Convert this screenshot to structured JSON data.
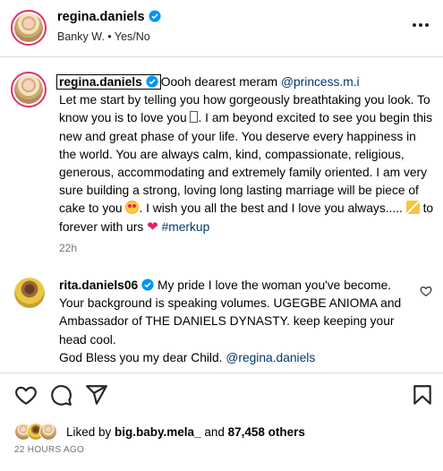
{
  "header": {
    "username": "regina.daniels",
    "subtitle": "Banky W. • Yes/No"
  },
  "caption": {
    "username": "regina.daniels",
    "text_1": "Oooh dearest meram ",
    "mention": "@princess.m.i",
    "text_2": "Let me start by telling you how gorgeously breathtaking you look. To know you is to love you ",
    "text_3": ". I am beyond excited to see you begin this new and great phase of your life. You deserve every happiness in the world. You are always calm, kind, compassionate, religious, generous, accommodating and extremely family oriented. I am very sure building a strong, loving long lasting marriage will be piece of cake to you ",
    "text_4": ". I wish you all the best and I love you always.....",
    "text_5": " to forever with urs ",
    "hashtag": "#merkup",
    "time": "22h"
  },
  "comment": {
    "username": "rita.daniels06",
    "text_1": " My pride I love the woman you've become. Your background is speaking volumes. UGEGBE ANIOMA and Ambassador of THE DANIELS DYNASTY. keep keeping your head cool.",
    "text_2": "God Bless you my dear Child. ",
    "mention": "@regina.daniels"
  },
  "likes": {
    "prefix": "Liked by ",
    "user": "big.baby.mela_",
    "middle": " and ",
    "count": "87,458 others"
  },
  "posted": "22 HOURS AGO",
  "icons": [
    "more-icon",
    "verified-icon",
    "heart-icon",
    "comment-icon",
    "share-icon",
    "save-icon"
  ],
  "colors": {
    "verified": "#0095f6",
    "mention": "#00376b",
    "heart": "#e0245e",
    "muted": "#737373"
  }
}
